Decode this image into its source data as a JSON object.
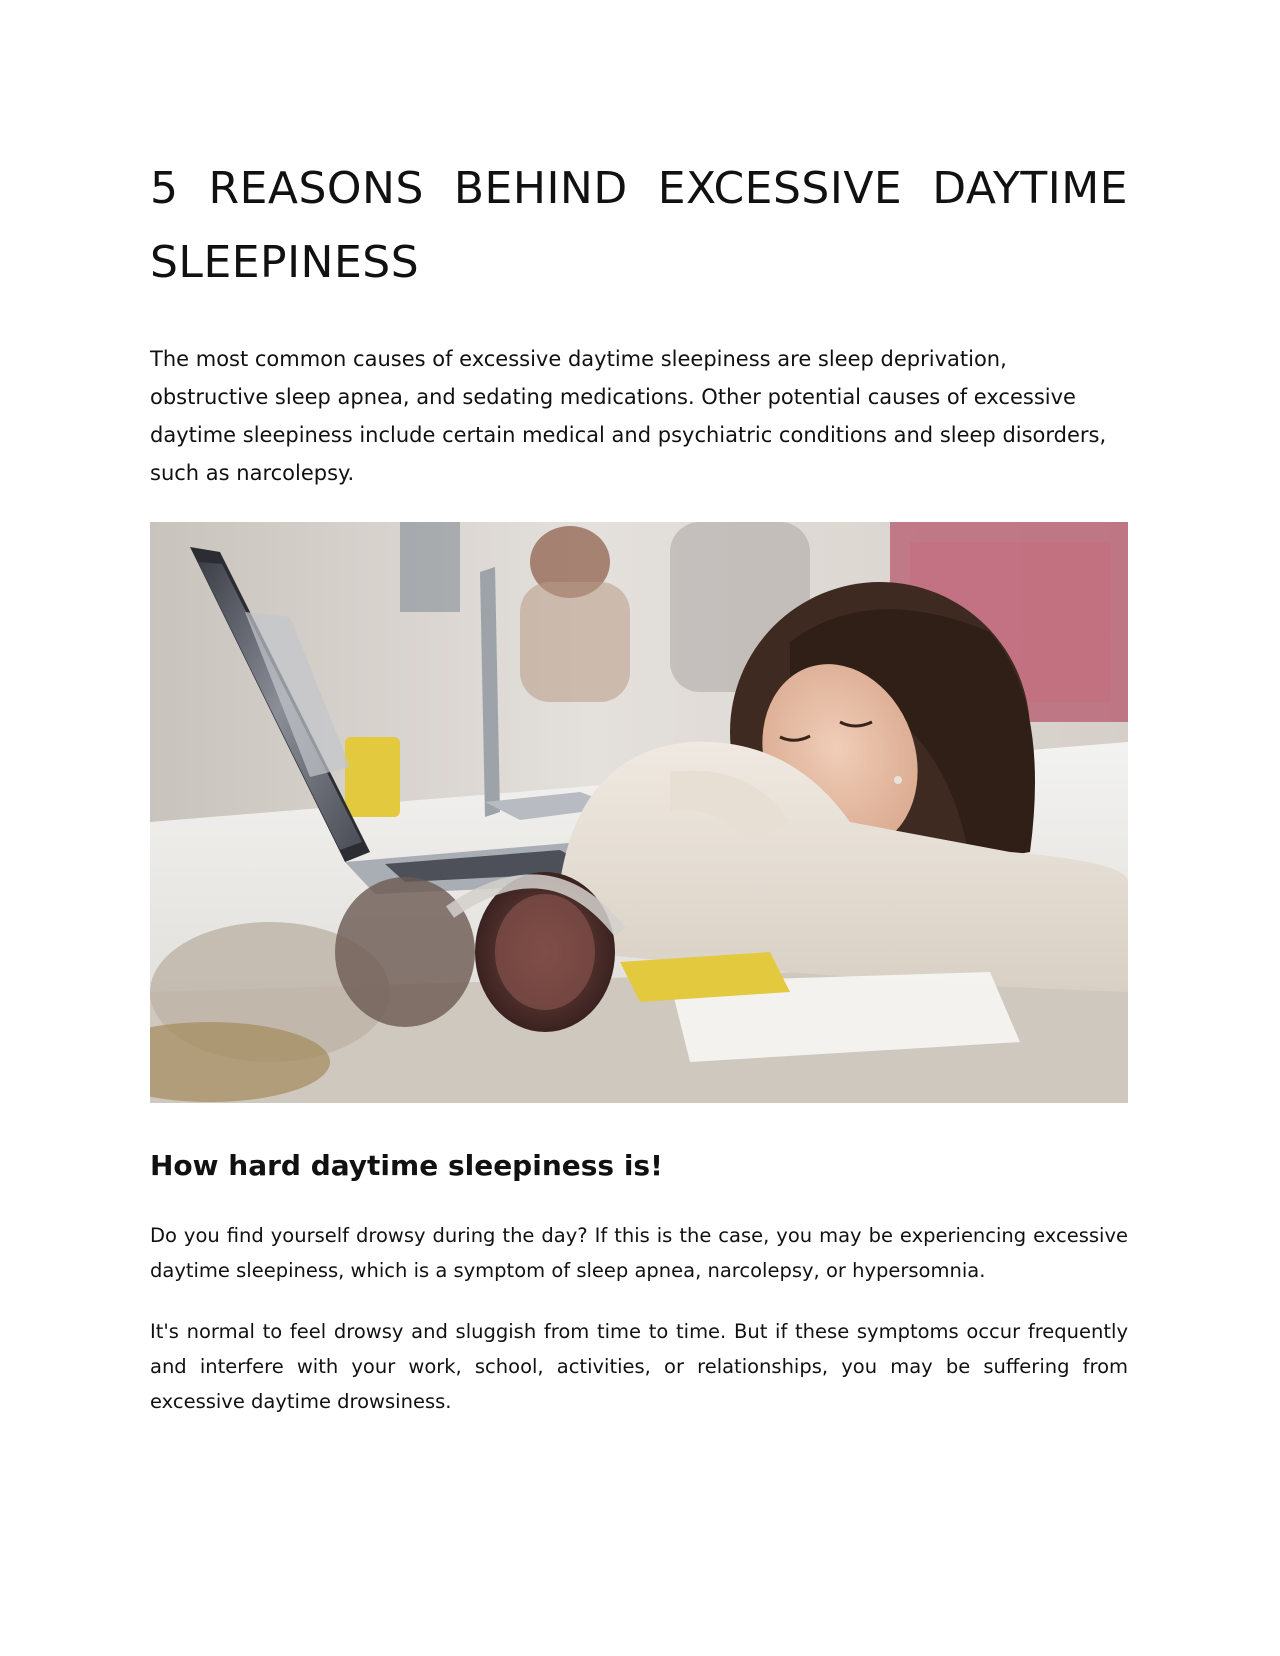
{
  "document": {
    "title": "5 REASONS BEHIND EXCESSIVE DAYTIME SLEEPINESS",
    "intro": "The most common causes of excessive daytime sleepiness are sleep deprivation, obstructive sleep apnea, and sedating medications. Other potential causes of excessive daytime sleepiness include certain medical and psychiatric conditions and sleep disorders, such as narcolepsy.",
    "image": {
      "subject": "student sleeping on desk next to laptop and headphones"
    },
    "section_heading": "How hard daytime sleepiness is!",
    "paragraphs": [
      "Do you find yourself drowsy during the day? If this is the case, you may be experiencing excessive daytime sleepiness, which is a symptom of sleep apnea, narcolepsy, or hypersomnia.",
      "It's normal to feel drowsy and sluggish from time to time. But if these symptoms occur frequently and interfere with your work, school, activities, or relationships, you may be suffering from excessive daytime drowsiness."
    ]
  }
}
